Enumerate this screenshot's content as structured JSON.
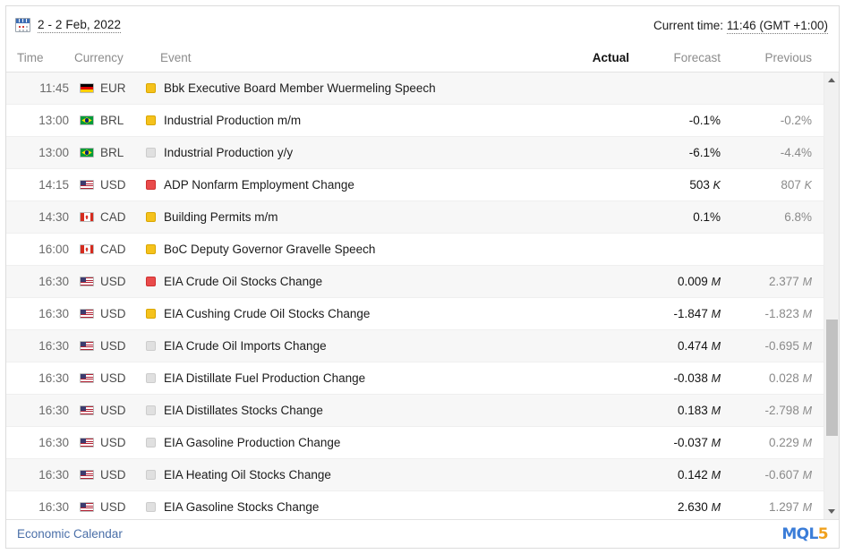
{
  "header": {
    "calendar_icon": "calendar-icon",
    "date_range": "2 - 2 Feb, 2022",
    "current_time_label": "Current time:",
    "current_time_value": "11:46 (GMT +1:00)"
  },
  "columns": {
    "time": "Time",
    "currency": "Currency",
    "event": "Event",
    "actual": "Actual",
    "forecast": "Forecast",
    "previous": "Previous"
  },
  "rows": [
    {
      "time": "11:45",
      "flag": "de",
      "currency": "EUR",
      "importance": "medium",
      "event": "Bbk Executive Board Member Wuermeling Speech",
      "actual": "",
      "forecast": "",
      "previous": ""
    },
    {
      "time": "13:00",
      "flag": "br",
      "currency": "BRL",
      "importance": "medium",
      "event": "Industrial Production m/m",
      "actual": "",
      "forecast": "-0.1%",
      "previous": "-0.2%"
    },
    {
      "time": "13:00",
      "flag": "br",
      "currency": "BRL",
      "importance": "low",
      "event": "Industrial Production y/y",
      "actual": "",
      "forecast": "-6.1%",
      "previous": "-4.4%"
    },
    {
      "time": "14:15",
      "flag": "us",
      "currency": "USD",
      "importance": "high",
      "event": "ADP Nonfarm Employment Change",
      "actual": "",
      "forecast": "503 K",
      "previous": "807 K"
    },
    {
      "time": "14:30",
      "flag": "ca",
      "currency": "CAD",
      "importance": "medium",
      "event": "Building Permits m/m",
      "actual": "",
      "forecast": "0.1%",
      "previous": "6.8%"
    },
    {
      "time": "16:00",
      "flag": "ca",
      "currency": "CAD",
      "importance": "medium",
      "event": "BoC Deputy Governor Gravelle Speech",
      "actual": "",
      "forecast": "",
      "previous": ""
    },
    {
      "time": "16:30",
      "flag": "us",
      "currency": "USD",
      "importance": "high",
      "event": "EIA Crude Oil Stocks Change",
      "actual": "",
      "forecast": "0.009 M",
      "previous": "2.377 M"
    },
    {
      "time": "16:30",
      "flag": "us",
      "currency": "USD",
      "importance": "medium",
      "event": "EIA Cushing Crude Oil Stocks Change",
      "actual": "",
      "forecast": "-1.847 M",
      "previous": "-1.823 M"
    },
    {
      "time": "16:30",
      "flag": "us",
      "currency": "USD",
      "importance": "low",
      "event": "EIA Crude Oil Imports Change",
      "actual": "",
      "forecast": "0.474 M",
      "previous": "-0.695 M"
    },
    {
      "time": "16:30",
      "flag": "us",
      "currency": "USD",
      "importance": "low",
      "event": "EIA Distillate Fuel Production Change",
      "actual": "",
      "forecast": "-0.038 M",
      "previous": "0.028 M"
    },
    {
      "time": "16:30",
      "flag": "us",
      "currency": "USD",
      "importance": "low",
      "event": "EIA Distillates Stocks Change",
      "actual": "",
      "forecast": "0.183 M",
      "previous": "-2.798 M"
    },
    {
      "time": "16:30",
      "flag": "us",
      "currency": "USD",
      "importance": "low",
      "event": "EIA Gasoline Production Change",
      "actual": "",
      "forecast": "-0.037 M",
      "previous": "0.229 M"
    },
    {
      "time": "16:30",
      "flag": "us",
      "currency": "USD",
      "importance": "low",
      "event": "EIA Heating Oil Stocks Change",
      "actual": "",
      "forecast": "0.142 M",
      "previous": "-0.607 M"
    },
    {
      "time": "16:30",
      "flag": "us",
      "currency": "USD",
      "importance": "low",
      "event": "EIA Gasoline Stocks Change",
      "actual": "",
      "forecast": "2.630 M",
      "previous": "1.297 M"
    }
  ],
  "scrollbar": {
    "up_arrow": "scroll-up-arrow",
    "down_arrow": "scroll-down-arrow",
    "thumb_top_pct": 52,
    "thumb_height_pct": 26
  },
  "footer": {
    "link": "Economic Calendar",
    "logo_main": "MQL",
    "logo_accent": "5"
  },
  "colors": {
    "high": "#e94b4b",
    "medium": "#f5c21c",
    "low": "#e0e0e0",
    "link": "#4a6fa8",
    "logo_blue": "#3b7dd8",
    "logo_orange": "#f0a11e"
  }
}
